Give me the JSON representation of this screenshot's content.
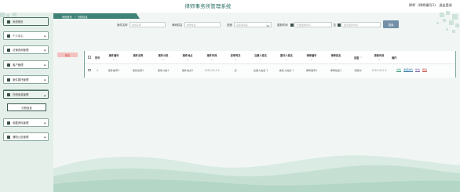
{
  "header": {
    "app_title": "律师事务所管理系统",
    "user_role": "律师",
    "user_name": "律师编号1",
    "logout": "退出登录"
  },
  "sidebar": {
    "items": [
      {
        "label": "系统首页",
        "icon": "home-icon"
      },
      {
        "label": "个人中心",
        "icon": "user-icon"
      },
      {
        "label": "法律咨询管理",
        "icon": "grid-icon"
      },
      {
        "label": "客户管理",
        "icon": "user-icon"
      },
      {
        "label": "案件委托管理",
        "icon": "grid-icon"
      },
      {
        "label": "开庭通知管理",
        "icon": "grid-icon"
      },
      {
        "label": "归档信息管理",
        "icon": "doc-icon"
      }
    ],
    "sub_items": [
      {
        "label": "归档信息"
      }
    ],
    "items_after": [
      {
        "label": "收藏资料管理",
        "icon": "grid-icon"
      },
      {
        "label": "通知公告管理",
        "icon": "grid-icon"
      }
    ]
  },
  "breadcrumb": {
    "home": "系统首页",
    "separator": "/",
    "current": "归档信息"
  },
  "search": {
    "case_name_label": "案件名称",
    "case_name_placeholder": "案件名称",
    "lawyer_name_label": "律师姓名",
    "lawyer_name_placeholder": "律师姓名",
    "status_label": "进度",
    "status_placeholder": "请选择进度",
    "date_label": "更新时间",
    "date_start_placeholder": "开始更新时间",
    "date_sep": "至",
    "date_end_placeholder": "结束更新时间",
    "search_button": "搜索"
  },
  "actions": {
    "delete_button": "删除"
  },
  "table": {
    "columns": [
      {
        "label": "序号",
        "sort": false
      },
      {
        "label": "案件编号",
        "sort": true
      },
      {
        "label": "案件名称",
        "sort": true
      },
      {
        "label": "案件分类",
        "sort": true
      },
      {
        "label": "案件地点",
        "sort": true
      },
      {
        "label": "案件时间",
        "sort": true
      },
      {
        "label": "初审判决",
        "sort": true
      },
      {
        "label": "当事人姓名",
        "sort": true
      },
      {
        "label": "委托人姓名",
        "sort": true
      },
      {
        "label": "律师编号",
        "sort": true
      },
      {
        "label": "律师姓名",
        "sort": true
      },
      {
        "label": "进度",
        "sort": false,
        "filter": true
      },
      {
        "label": "更新时间",
        "sort": true
      },
      {
        "label": "操作",
        "sort": false
      }
    ],
    "sort_mark": "⇕",
    "filter_mark": "▽",
    "rows": [
      {
        "index": "1",
        "case_no": "案件编号1",
        "case_name": "案件名称1",
        "case_type": "案件分类1",
        "case_place": "案件地点1",
        "case_time": "2025-05-2 8",
        "first_judgement": "无",
        "party_name": "当事人姓名 1",
        "client_name": "委托人姓名 1",
        "lawyer_no": "律师编号1",
        "lawyer_name": "律师姓名1",
        "status": "调查中",
        "updated": "2025-05-2 8",
        "ops": [
          "详情",
          "收藏资料",
          "修改",
          "删除"
        ]
      }
    ]
  },
  "colors": {
    "accent": "#3f8378",
    "sidebar_bg": "#e4efe9",
    "page_bg": "#f1f6f4",
    "danger": "#d0504a"
  }
}
